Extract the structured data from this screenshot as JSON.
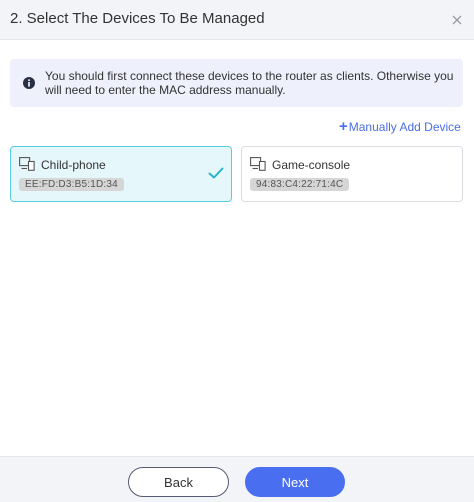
{
  "dialog": {
    "title": "2. Select The Devices To Be Managed",
    "close_icon": "close-icon"
  },
  "notice": {
    "icon": "info-icon",
    "text": "You should first connect these devices to the router as clients. Otherwise you will need to enter the MAC address manually."
  },
  "manual_add": {
    "icon": "plus-icon",
    "plus": "+",
    "label": "Manually Add Device"
  },
  "devices": [
    {
      "name": "Child-phone",
      "mac": "EE:FD:D3:B5:1D:34",
      "selected": true,
      "icon": "devices-icon"
    },
    {
      "name": "Game-console",
      "mac": "94:83:C4:22:71:4C",
      "selected": false,
      "icon": "devices-icon"
    }
  ],
  "footer": {
    "back_label": "Back",
    "next_label": "Next"
  },
  "colors": {
    "accent": "#4a6ef0",
    "selected_border": "#56cfe0",
    "selected_bg": "#e5f7fb",
    "check": "#2ab3c8",
    "notice_bg": "#eef0fb"
  }
}
